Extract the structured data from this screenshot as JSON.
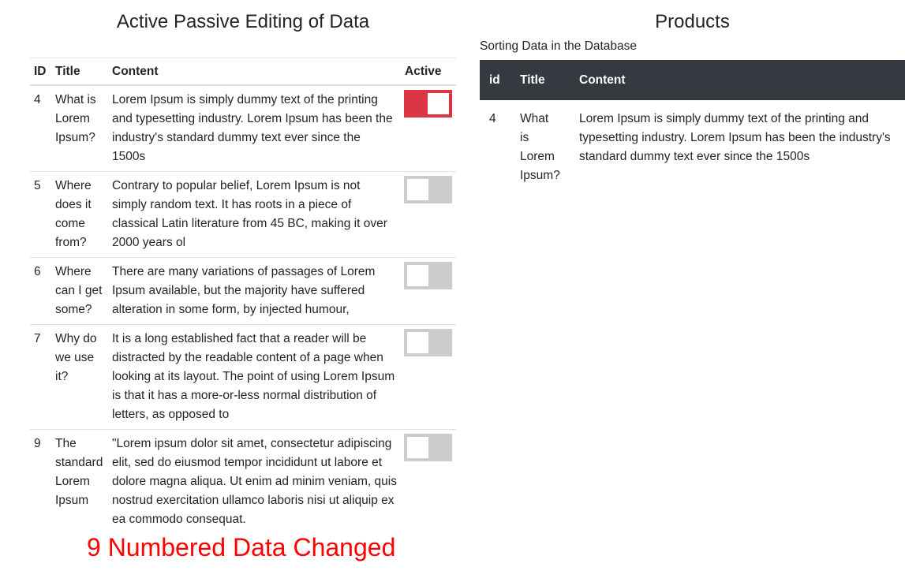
{
  "left": {
    "title": "Active Passive Editing of Data",
    "headers": {
      "id": "ID",
      "title": "Title",
      "content": "Content",
      "active": "Active"
    },
    "rows": [
      {
        "id": "4",
        "title": "What is Lorem Ipsum?",
        "content": "Lorem Ipsum is simply dummy text of the printing and typesetting industry. Lorem Ipsum has been the industry's standard dummy text ever since the 1500s",
        "active": true
      },
      {
        "id": "5",
        "title": "Where does it come from?",
        "content": "Contrary to popular belief, Lorem Ipsum is not simply random text. It has roots in a piece of classical Latin literature from 45 BC, making it over 2000 years ol",
        "active": false
      },
      {
        "id": "6",
        "title": "Where can I get some?",
        "content": "There are many variations of passages of Lorem Ipsum available, but the majority have suffered alteration in some form, by injected humour,",
        "active": false
      },
      {
        "id": "7",
        "title": "Why do we use it?",
        "content": "It is a long established fact that a reader will be distracted by the readable content of a page when looking at its layout. The point of using Lorem Ipsum is that it has a more-or-less normal distribution of letters, as opposed to",
        "active": false
      },
      {
        "id": "9",
        "title": "The standard Lorem Ipsum",
        "content": "\"Lorem ipsum dolor sit amet, consectetur adipiscing elit, sed do eiusmod tempor incididunt ut labore et dolore magna aliqua. Ut enim ad minim veniam, quis nostrud exercitation ullamco laboris nisi ut aliquip ex ea commodo consequat.",
        "active": false
      }
    ],
    "status_message": "9 Numbered Data Changed"
  },
  "right": {
    "title": "Products",
    "caption": "Sorting Data in the Database",
    "headers": {
      "id": "id",
      "title": "Title",
      "content": "Content"
    },
    "rows": [
      {
        "id": "4",
        "title": "What is Lorem Ipsum?",
        "content": "Lorem Ipsum is simply dummy text of the printing and typesetting industry. Lorem Ipsum has been the industry's standard dummy text ever since the 1500s"
      }
    ]
  },
  "colors": {
    "toggle_on": "#dc3545",
    "toggle_off": "#cccccc",
    "header_dark": "#343a40",
    "status": "#ff0000"
  }
}
